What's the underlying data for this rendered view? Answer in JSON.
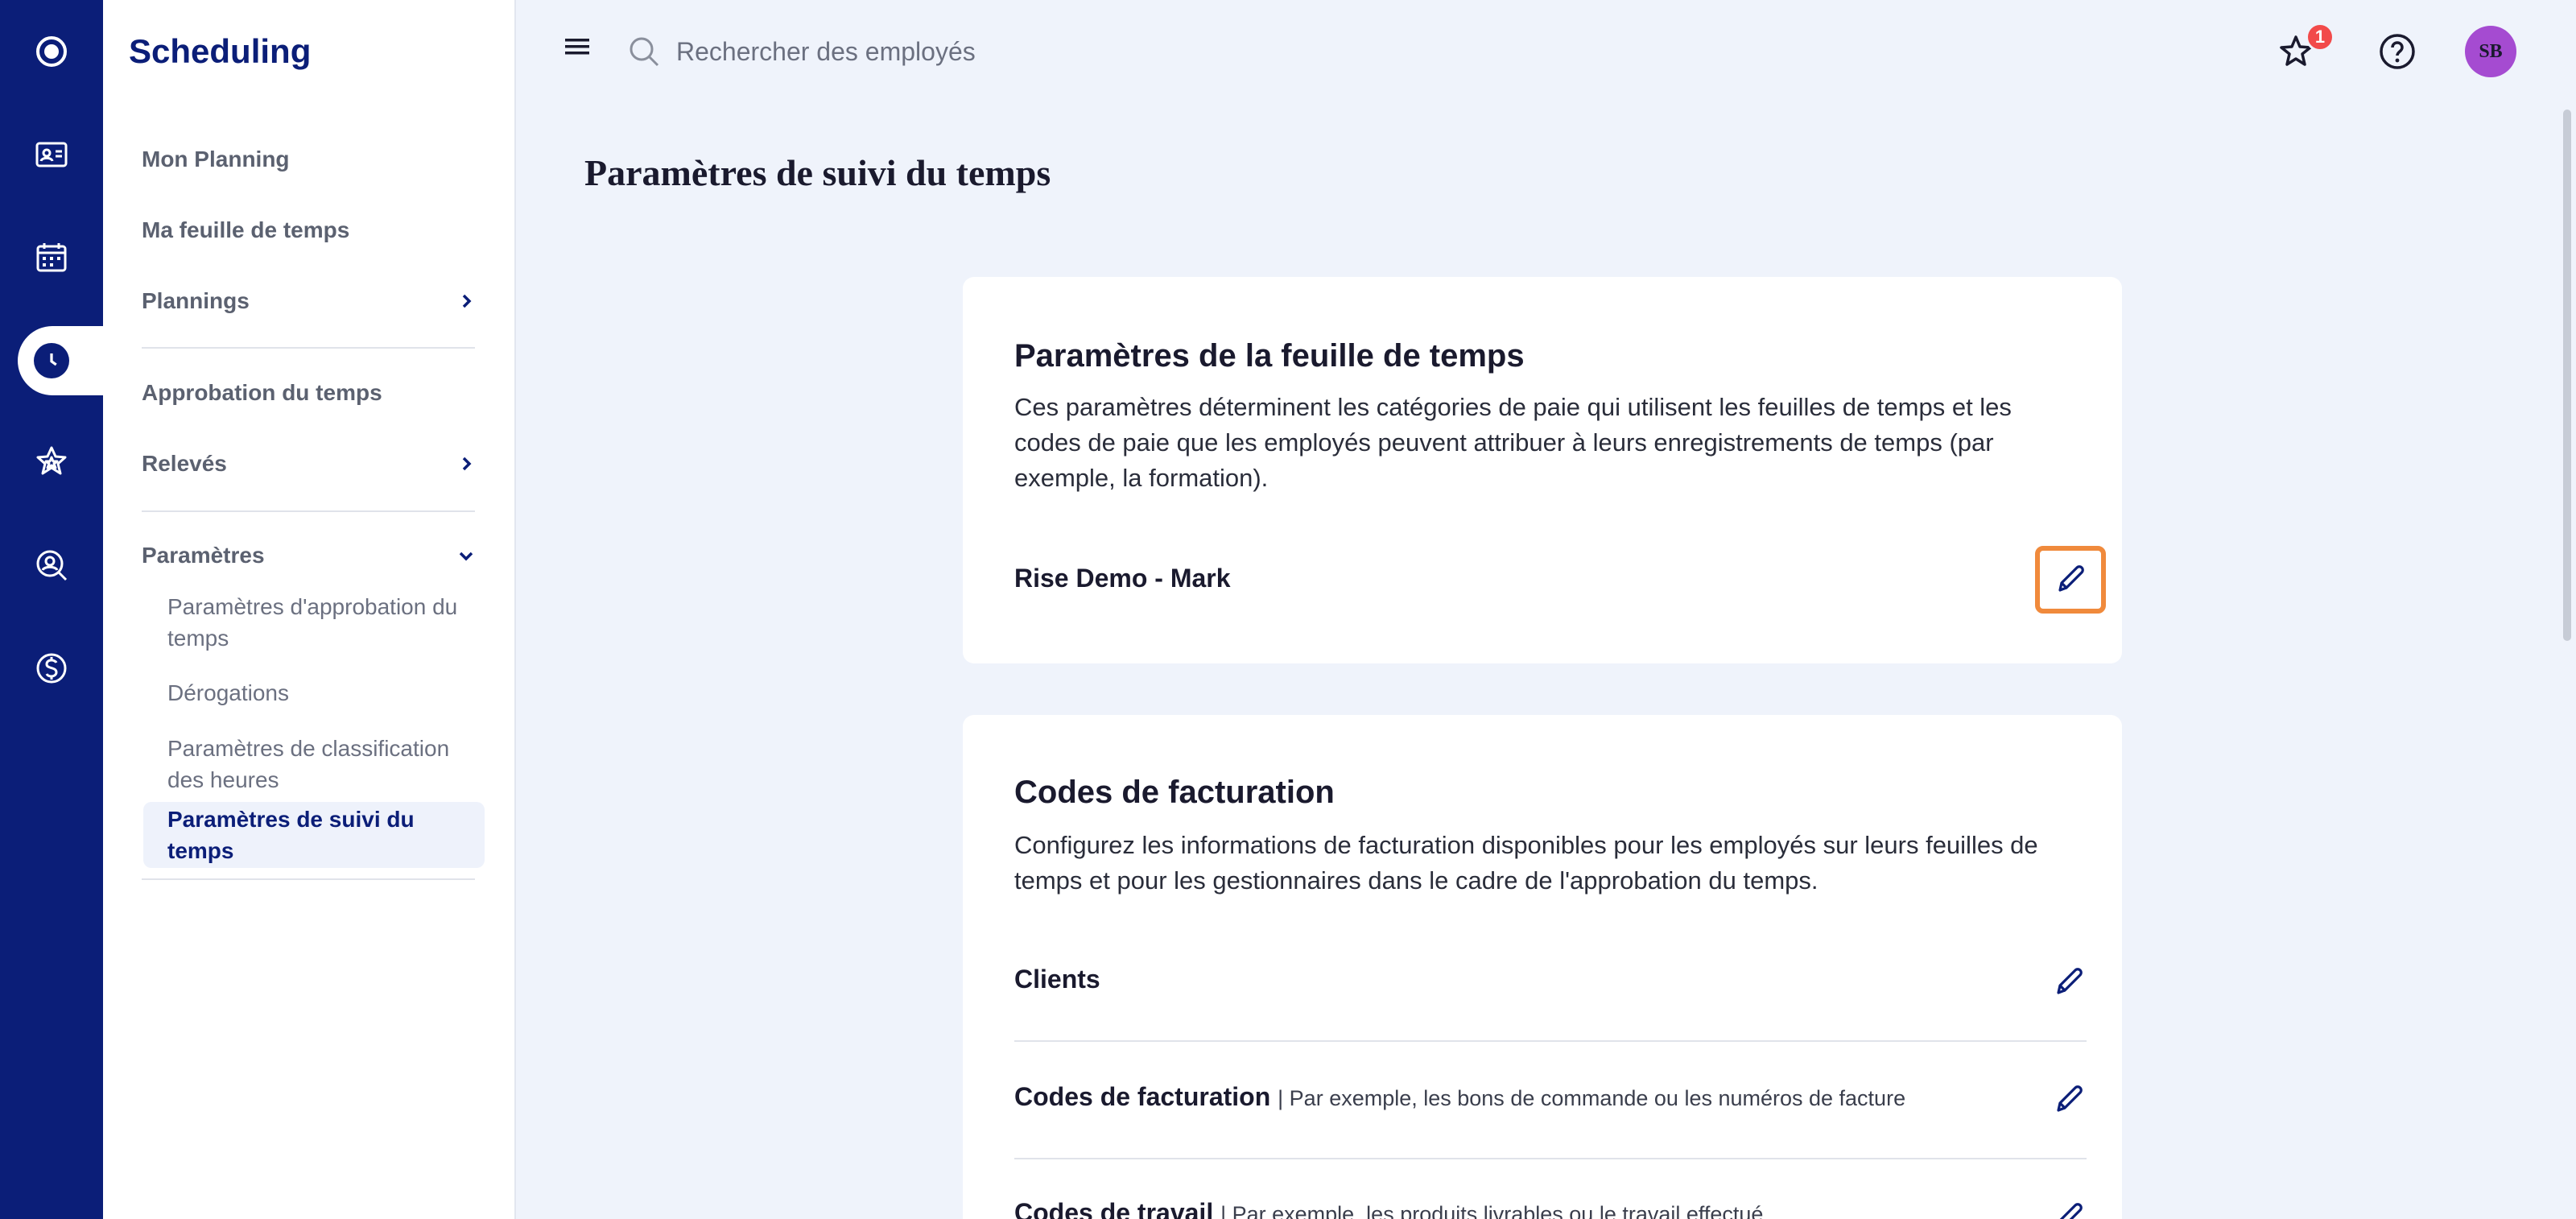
{
  "app": {
    "title": "Scheduling"
  },
  "sidebar": {
    "items": [
      {
        "label": "Mon Planning"
      },
      {
        "label": "Ma feuille de temps"
      },
      {
        "label": "Plannings"
      },
      {
        "label": "Approbation du temps"
      },
      {
        "label": "Relevés"
      },
      {
        "label": "Paramètres"
      }
    ],
    "sub_items": [
      {
        "label": "Paramètres d'approbation du temps"
      },
      {
        "label": "Dérogations"
      },
      {
        "label": "Paramètres de classification des heures"
      },
      {
        "label": "Paramètres de suivi du temps"
      }
    ]
  },
  "header": {
    "search_placeholder": "Rechercher des employés",
    "notification_count": "1",
    "avatar_initials": "SB"
  },
  "main": {
    "page_title": "Paramètres de suivi du temps",
    "timesheet_card": {
      "title": "Paramètres de la feuille de temps",
      "description": "Ces paramètres déterminent les catégories de paie qui utilisent les feuilles de temps et les codes de paie que les employés peuvent attribuer à leurs enregistrements de temps (par exemple, la formation).",
      "row_label": "Rise Demo - Mark"
    },
    "billing_card": {
      "title": "Codes de facturation",
      "description": "Configurez les informations de facturation disponibles pour les employés sur leurs feuilles de temps et pour les gestionnaires dans le cadre de l'approbation du temps.",
      "rows": [
        {
          "label": "Clients",
          "hint": ""
        },
        {
          "label": "Codes de facturation",
          "hint": "Par exemple, les bons de commande ou les numéros de facture"
        },
        {
          "label": "Codes de travail",
          "hint": "Par exemple, les produits livrables ou le travail effectué"
        }
      ]
    }
  },
  "colors": {
    "brand": "#0b1e78",
    "background": "#eff3fb",
    "focus_outline": "#f08a3c",
    "badge": "#f24a4a",
    "avatar": "#a54bd1"
  }
}
